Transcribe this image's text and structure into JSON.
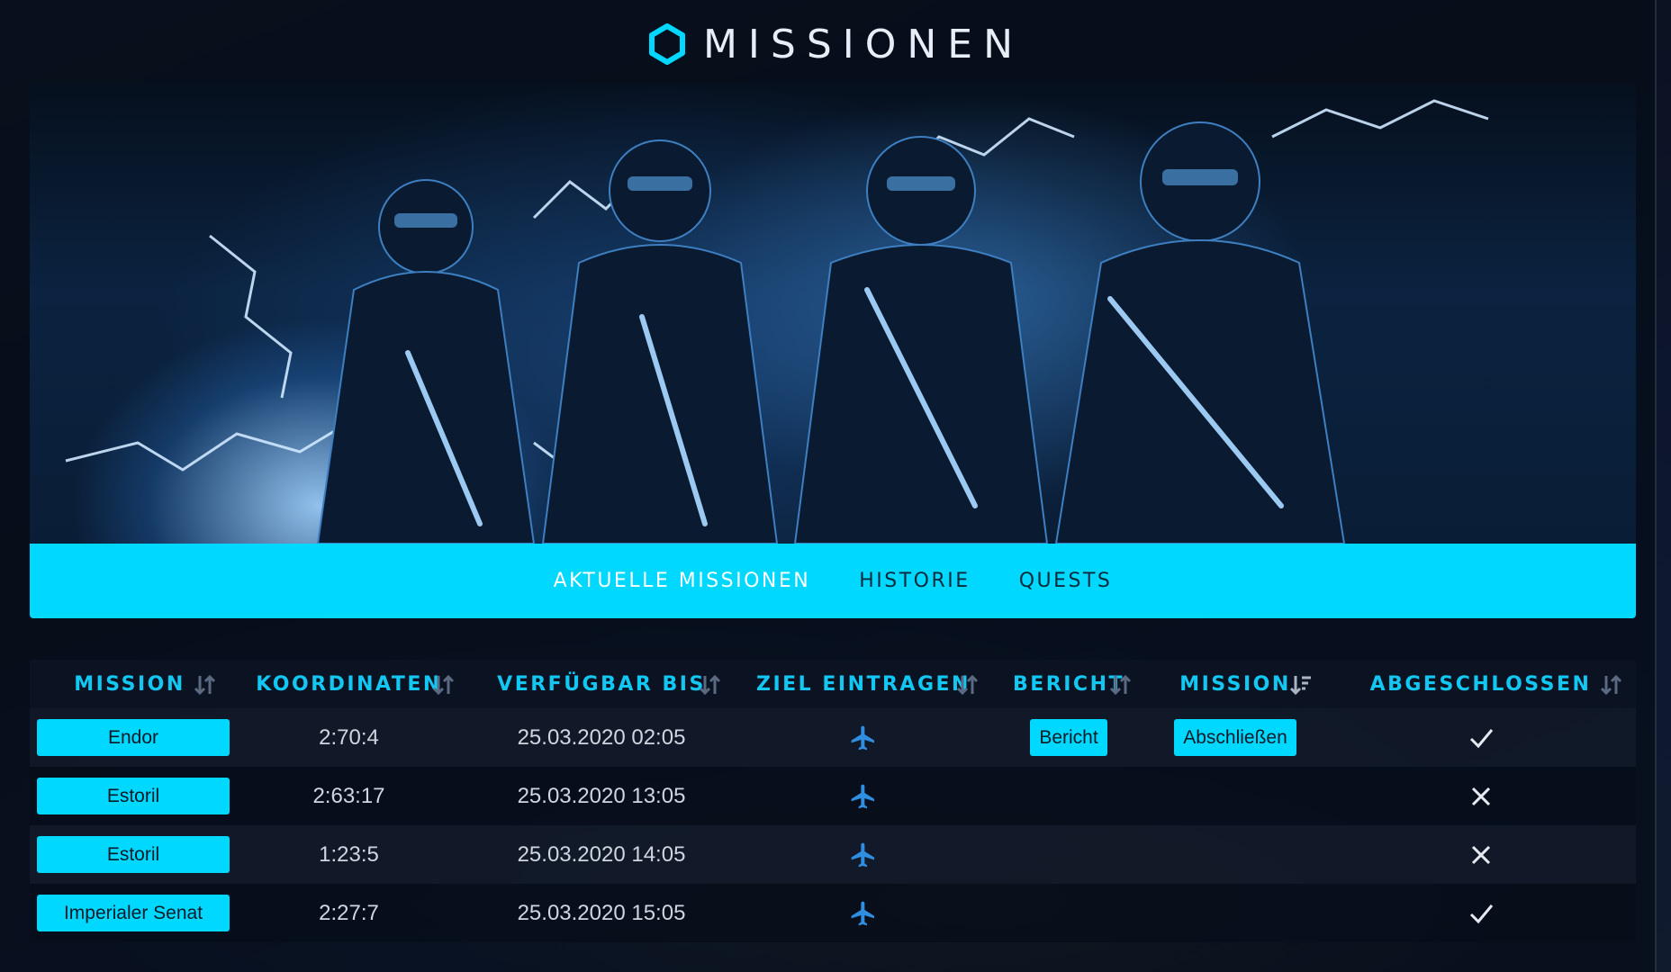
{
  "header": {
    "title": "MISSIONEN",
    "logo_icon": "hexagon-icon",
    "accent": "#00d8ff"
  },
  "hero": {
    "alt": "hero-banner"
  },
  "tabs": [
    {
      "label": "AKTUELLE MISSIONEN",
      "active": true
    },
    {
      "label": "HISTORIE",
      "active": false
    },
    {
      "label": "QUESTS",
      "active": false
    }
  ],
  "table": {
    "columns": [
      "MISSION",
      "KOORDINATEN",
      "VERFÜGBAR BIS",
      "ZIEL EINTRAGEN",
      "BERICHT",
      "MISSION",
      "ABGESCHLOSSEN"
    ],
    "rows": [
      {
        "mission": "Endor",
        "coords": "2:70:4",
        "until": "25.03.2020 02:05",
        "report": "Bericht",
        "action": "Abschließen",
        "done": true
      },
      {
        "mission": "Estoril",
        "coords": "2:63:17",
        "until": "25.03.2020 13:05",
        "report": "",
        "action": "",
        "done": false
      },
      {
        "mission": "Estoril",
        "coords": "1:23:5",
        "until": "25.03.2020 14:05",
        "report": "",
        "action": "",
        "done": false
      },
      {
        "mission": "Imperialer Senat",
        "coords": "2:27:7",
        "until": "25.03.2020 15:05",
        "report": "",
        "action": "",
        "done": true
      }
    ]
  }
}
